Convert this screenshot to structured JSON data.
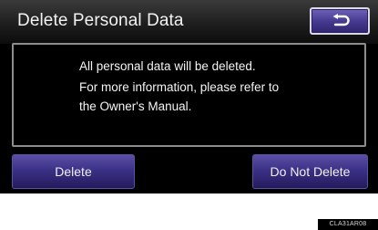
{
  "screen": {
    "title": "Delete Personal Data",
    "back_button": {
      "icon": "return-arrow-icon"
    },
    "message": {
      "lines": [
        "All personal data will be deleted.",
        "For more information, please refer to",
        "the Owner's Manual."
      ]
    },
    "buttons": {
      "delete_label": "Delete",
      "do_not_delete_label": "Do Not Delete"
    }
  },
  "image_code": "CLA31AR08",
  "colors": {
    "button_purple": "#3b3186",
    "panel_border": "#8d8d8d",
    "background": "#000000"
  }
}
